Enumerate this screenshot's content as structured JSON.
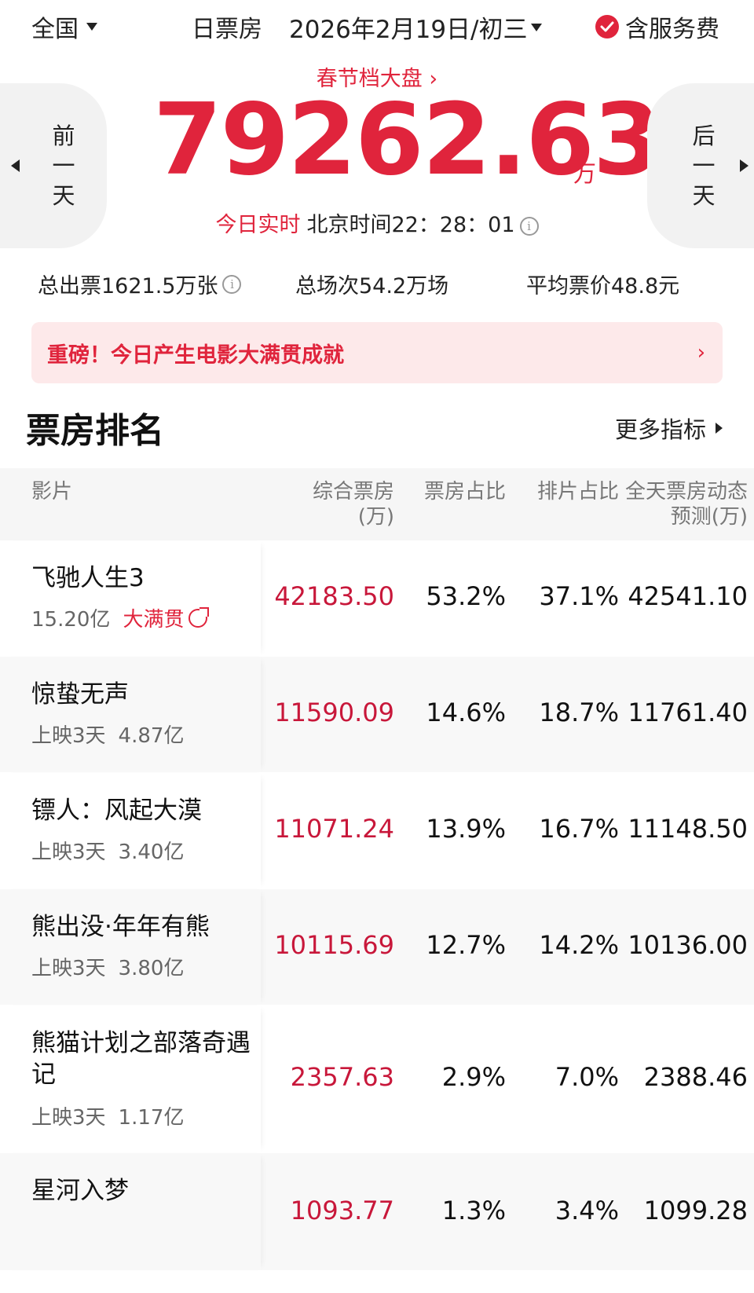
{
  "header": {
    "region": "全国",
    "mode": "日票房",
    "date": "2026年2月19日/初三",
    "service_fee": "含服务费"
  },
  "hero": {
    "season_link": "春节档大盘",
    "prev_day": "前一天",
    "next_day": "后一天",
    "box_office": "79262.63",
    "unit": "万",
    "realtime_label": "今日实时",
    "beijing_time": "北京时间22：28：01"
  },
  "stats": {
    "tickets": "总出票1621.5万张",
    "shows": "总场次54.2万场",
    "avg_price": "平均票价48.8元"
  },
  "banner": {
    "text": "重磅！今日产生电影大满贯成就",
    "arrow": "›"
  },
  "ranking": {
    "title": "票房排名",
    "more": "更多指标",
    "columns": {
      "film": "影片",
      "box_office": "综合票房(万)",
      "box_share": "票房占比",
      "schedule_share": "排片占比",
      "forecast": "全天票房动态预测(万)"
    },
    "rows": [
      {
        "title": "飞驰人生3",
        "total": "15.20亿",
        "badge": "大满贯",
        "days": "",
        "box_office": "42183.50",
        "box_share": "53.2%",
        "schedule_share": "37.1%",
        "forecast": "42541.10"
      },
      {
        "title": "惊蛰无声",
        "total": "4.87亿",
        "badge": "",
        "days": "上映3天",
        "box_office": "11590.09",
        "box_share": "14.6%",
        "schedule_share": "18.7%",
        "forecast": "11761.40"
      },
      {
        "title": "镖人：风起大漠",
        "total": "3.40亿",
        "badge": "",
        "days": "上映3天",
        "box_office": "11071.24",
        "box_share": "13.9%",
        "schedule_share": "16.7%",
        "forecast": "11148.50"
      },
      {
        "title": "熊出没·年年有熊",
        "total": "3.80亿",
        "badge": "",
        "days": "上映3天",
        "box_office": "10115.69",
        "box_share": "12.7%",
        "schedule_share": "14.2%",
        "forecast": "10136.00"
      },
      {
        "title": "熊猫计划之部落奇遇记",
        "total": "1.17亿",
        "badge": "",
        "days": "上映3天",
        "box_office": "2357.63",
        "box_share": "2.9%",
        "schedule_share": "7.0%",
        "forecast": "2388.46"
      },
      {
        "title": "星河入梦",
        "total": "",
        "badge": "",
        "days": "",
        "box_office": "1093.77",
        "box_share": "1.3%",
        "schedule_share": "3.4%",
        "forecast": "1099.28"
      }
    ]
  },
  "colors": {
    "accent": "#e0243c",
    "banner_bg": "#fde9ea",
    "value_red": "#c8173a"
  },
  "icons": [
    "caret-down-icon",
    "check-circle-icon",
    "chevron-right-icon",
    "triangle-left-icon",
    "triangle-right-icon",
    "info-icon",
    "external-link-icon"
  ]
}
